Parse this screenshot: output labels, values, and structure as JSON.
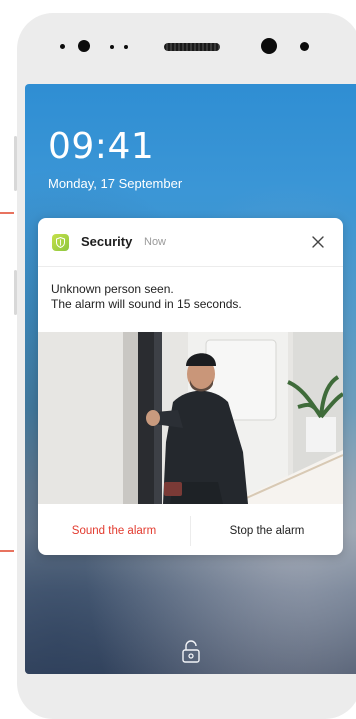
{
  "lock_screen": {
    "time": "09:41",
    "date": "Monday, 17 September"
  },
  "notification": {
    "app_name": "Security",
    "timestamp": "Now",
    "message_lines": [
      "Unknown person seen.",
      "The alarm will sound in 15 seconds."
    ],
    "actions": {
      "primary": "Sound the alarm",
      "secondary": "Stop the alarm"
    }
  },
  "icons": {
    "app": "shield-icon",
    "close": "close-icon",
    "lock": "lock-icon"
  },
  "colors": {
    "accent_danger": "#e23a2e",
    "app_icon": "#a7d34a",
    "wallpaper_top": "#2f8ed3",
    "guide_marks": "#e8735f"
  }
}
